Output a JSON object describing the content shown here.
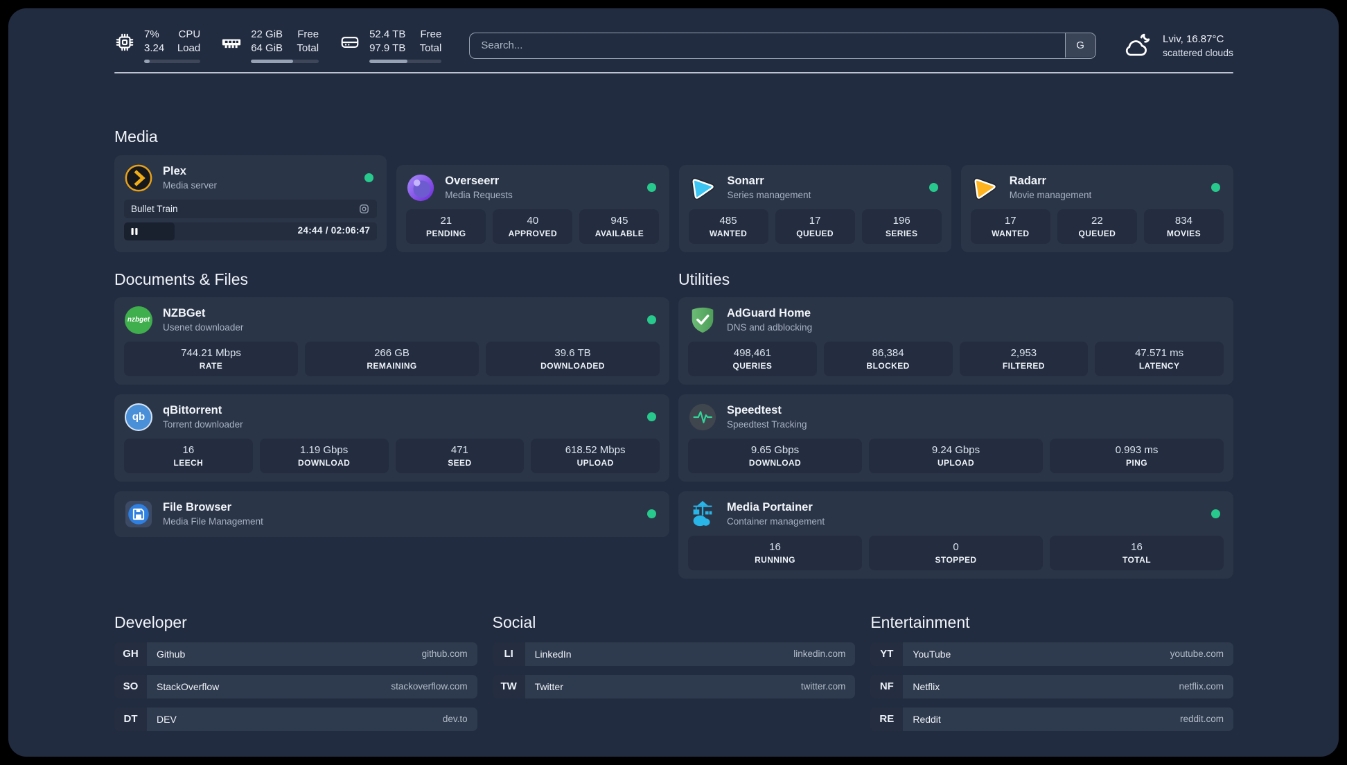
{
  "colors": {
    "page_background": "#000000",
    "panel_background": "#222c40",
    "card_background": "#2b3548",
    "tile_background": "#232d3f",
    "status_online": "#28c98c",
    "text_primary": "#eef2f8",
    "text_secondary": "#a7b2c3",
    "plex_brand": "#e8a117",
    "sonarr_brand": "#3cc5f3",
    "radarr_brand": "#ffb41f",
    "portainer_brand": "#29b5e8"
  },
  "header": {
    "cpu": {
      "usage": "7%",
      "load": "3.24",
      "label_top": "CPU",
      "label_bottom": "Load",
      "progress": 10
    },
    "memory": {
      "free": "22 GiB",
      "total": "64 GiB",
      "label_top": "Free",
      "label_bottom": "Total",
      "progress": 62
    },
    "disk": {
      "free": "52.4 TB",
      "total": "97.9 TB",
      "label_top": "Free",
      "label_bottom": "Total",
      "progress": 53
    },
    "search": {
      "placeholder": "Search...",
      "provider_label": "G"
    },
    "weather": {
      "location": "Lviv, 16.87°C",
      "condition": "scattered clouds"
    }
  },
  "groups": {
    "media": {
      "title": "Media",
      "services": [
        {
          "name": "Plex",
          "description": "Media server",
          "icon": "plex-icon",
          "online": true,
          "now_playing": {
            "title": "Bullet Train",
            "time": "24:44 / 02:06:47",
            "progress": 20
          }
        },
        {
          "name": "Overseerr",
          "description": "Media Requests",
          "icon": "overseerr-icon",
          "online": true,
          "stats": [
            {
              "value": "21",
              "label": "PENDING"
            },
            {
              "value": "40",
              "label": "APPROVED"
            },
            {
              "value": "945",
              "label": "AVAILABLE"
            }
          ]
        },
        {
          "name": "Sonarr",
          "description": "Series management",
          "icon": "sonarr-icon",
          "online": true,
          "stats": [
            {
              "value": "485",
              "label": "WANTED"
            },
            {
              "value": "17",
              "label": "QUEUED"
            },
            {
              "value": "196",
              "label": "SERIES"
            }
          ]
        },
        {
          "name": "Radarr",
          "description": "Movie management",
          "icon": "radarr-icon",
          "online": true,
          "stats": [
            {
              "value": "17",
              "label": "WANTED"
            },
            {
              "value": "22",
              "label": "QUEUED"
            },
            {
              "value": "834",
              "label": "MOVIES"
            }
          ]
        }
      ]
    },
    "documents": {
      "title": "Documents & Files",
      "services": [
        {
          "name": "NZBGet",
          "description": "Usenet downloader",
          "icon": "nzbget-icon",
          "online": true,
          "stats": [
            {
              "value": "744.21 Mbps",
              "label": "RATE"
            },
            {
              "value": "266 GB",
              "label": "REMAINING"
            },
            {
              "value": "39.6 TB",
              "label": "DOWNLOADED"
            }
          ]
        },
        {
          "name": "qBittorrent",
          "description": "Torrent downloader",
          "icon": "qbittorrent-icon",
          "online": true,
          "stats": [
            {
              "value": "16",
              "label": "LEECH"
            },
            {
              "value": "1.19 Gbps",
              "label": "DOWNLOAD"
            },
            {
              "value": "471",
              "label": "SEED"
            },
            {
              "value": "618.52 Mbps",
              "label": "UPLOAD"
            }
          ]
        },
        {
          "name": "File Browser",
          "description": "Media File Management",
          "icon": "filebrowser-icon",
          "online": true,
          "stats": []
        }
      ]
    },
    "utilities": {
      "title": "Utilities",
      "services": [
        {
          "name": "AdGuard Home",
          "description": "DNS and adblocking",
          "icon": "adguard-icon",
          "online": false,
          "stats": [
            {
              "value": "498,461",
              "label": "QUERIES"
            },
            {
              "value": "86,384",
              "label": "BLOCKED"
            },
            {
              "value": "2,953",
              "label": "FILTERED"
            },
            {
              "value": "47.571 ms",
              "label": "LATENCY"
            }
          ]
        },
        {
          "name": "Speedtest",
          "description": "Speedtest Tracking",
          "icon": "speedtest-icon",
          "online": false,
          "stats": [
            {
              "value": "9.65 Gbps",
              "label": "DOWNLOAD"
            },
            {
              "value": "9.24 Gbps",
              "label": "UPLOAD"
            },
            {
              "value": "0.993 ms",
              "label": "PING"
            }
          ]
        },
        {
          "name": "Media Portainer",
          "description": "Container management",
          "icon": "portainer-icon",
          "online": true,
          "stats": [
            {
              "value": "16",
              "label": "RUNNING"
            },
            {
              "value": "0",
              "label": "STOPPED"
            },
            {
              "value": "16",
              "label": "TOTAL"
            }
          ]
        }
      ]
    }
  },
  "bookmarks": {
    "developer": {
      "title": "Developer",
      "items": [
        {
          "abbr": "GH",
          "name": "Github",
          "url": "github.com"
        },
        {
          "abbr": "SO",
          "name": "StackOverflow",
          "url": "stackoverflow.com"
        },
        {
          "abbr": "DT",
          "name": "DEV",
          "url": "dev.to"
        }
      ]
    },
    "social": {
      "title": "Social",
      "items": [
        {
          "abbr": "LI",
          "name": "LinkedIn",
          "url": "linkedin.com"
        },
        {
          "abbr": "TW",
          "name": "Twitter",
          "url": "twitter.com"
        }
      ]
    },
    "entertainment": {
      "title": "Entertainment",
      "items": [
        {
          "abbr": "YT",
          "name": "YouTube",
          "url": "youtube.com"
        },
        {
          "abbr": "NF",
          "name": "Netflix",
          "url": "netflix.com"
        },
        {
          "abbr": "RE",
          "name": "Reddit",
          "url": "reddit.com"
        }
      ]
    }
  }
}
